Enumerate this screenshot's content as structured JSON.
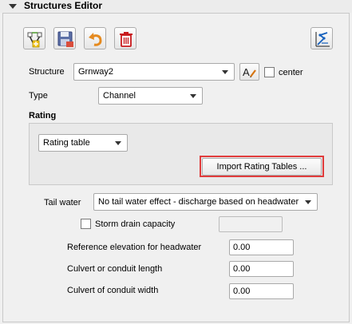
{
  "panel": {
    "title": "Structures Editor"
  },
  "toolbar": {
    "buttons": [
      {
        "name": "add-structure-icon"
      },
      {
        "name": "save-icon"
      },
      {
        "name": "undo-icon"
      },
      {
        "name": "delete-icon"
      }
    ],
    "right_button": {
      "name": "schematize-icon"
    }
  },
  "structure": {
    "label": "Structure",
    "value": "Grnway2",
    "center_label": "center"
  },
  "type": {
    "label": "Type",
    "value": "Channel"
  },
  "rating": {
    "label": "Rating",
    "value": "Rating table",
    "import_button": "Import Rating Tables ..."
  },
  "tailwater": {
    "label": "Tail water",
    "value": "No tail water effect - discharge based on headwater"
  },
  "storm_drain": {
    "label": "Storm drain capacity",
    "value": ""
  },
  "fields": {
    "ref_elev": {
      "label": "Reference elevation for headwater",
      "value": "0.00"
    },
    "culvert_length": {
      "label": "Culvert or conduit length",
      "value": "0.00"
    },
    "culvert_width": {
      "label": "Culvert of conduit width",
      "value": "0.00"
    }
  },
  "colors": {
    "highlight": "#e03c3c",
    "accent": "#0a5aa8"
  }
}
